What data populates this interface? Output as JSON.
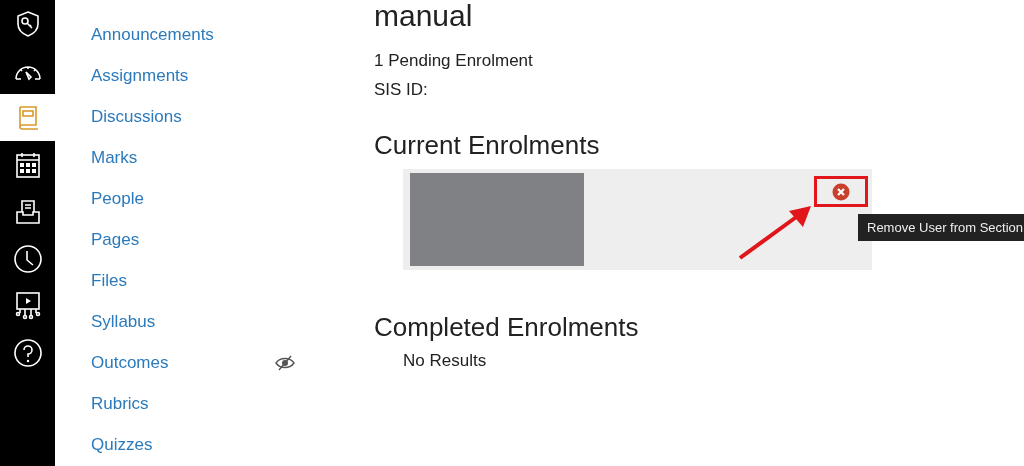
{
  "global_nav": [
    {
      "kind": "admin",
      "selected": false
    },
    {
      "kind": "dashboard",
      "selected": false
    },
    {
      "kind": "courses",
      "selected": true
    },
    {
      "kind": "calendar",
      "selected": false
    },
    {
      "kind": "inbox",
      "selected": false
    },
    {
      "kind": "history",
      "selected": false
    },
    {
      "kind": "studio",
      "selected": false
    },
    {
      "kind": "help",
      "selected": false
    }
  ],
  "course_nav": [
    {
      "label": "Announcements",
      "hidden": false
    },
    {
      "label": "Assignments",
      "hidden": false
    },
    {
      "label": "Discussions",
      "hidden": false
    },
    {
      "label": "Marks",
      "hidden": false
    },
    {
      "label": "People",
      "hidden": false
    },
    {
      "label": "Pages",
      "hidden": false
    },
    {
      "label": "Files",
      "hidden": false
    },
    {
      "label": "Syllabus",
      "hidden": false
    },
    {
      "label": "Outcomes",
      "hidden": true
    },
    {
      "label": "Rubrics",
      "hidden": false
    },
    {
      "label": "Quizzes",
      "hidden": false
    }
  ],
  "section": {
    "title": "manual",
    "pending": "1 Pending Enrolment",
    "sis_id": "SIS ID:"
  },
  "current": {
    "heading": "Current Enrolments",
    "tooltip": "Remove User from Section",
    "highlighted": true
  },
  "completed": {
    "heading": "Completed Enrolments",
    "empty": "No Results"
  }
}
